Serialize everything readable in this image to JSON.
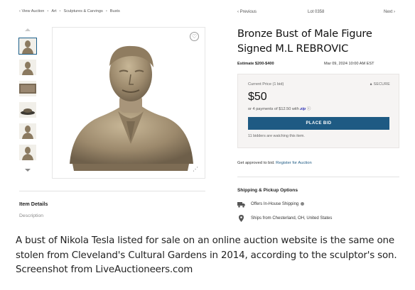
{
  "breadcrumb": {
    "back": "View Auction",
    "items": [
      "Art",
      "Sculptures & Carvings",
      "Busts"
    ],
    "back_glyph": "‹"
  },
  "gallery": {
    "thumbnail_count": 6,
    "selected_index": 0,
    "favorite_icon": "heart-icon",
    "share_icon": "share-icon"
  },
  "nav": {
    "previous": "‹ Previous",
    "lot": "Lot 0358",
    "next": "Next ›"
  },
  "lot": {
    "title": "Bronze Bust of Male Figure Signed M.L REBROVIC",
    "estimate": "Estimate $200-$400",
    "date": "Mar 09, 2024 10:00 AM EST"
  },
  "bidding": {
    "current_label": "Current Price (1 bid)",
    "secure_label": "SECURE",
    "price": "$50",
    "payments_prefix": "or 4 payments of $12.50 with",
    "payments_brand": "zip",
    "button_label": "PLACE BID",
    "watching": "11 bidders are watching this item."
  },
  "approval": {
    "text": "Get approved to bid.",
    "link": "Register for Auction"
  },
  "details": {
    "heading": "Item Details",
    "description_label": "Description"
  },
  "shipping": {
    "heading": "Shipping & Pickup Options",
    "option_1": "Offers In-House Shipping",
    "option_2": "Ships from Chesterland, OH, United States"
  },
  "caption": "A bust of Nikola Tesla listed for sale on an online auction website is the same one stolen from Cleveland's Cultural Gardens in 2014, according to the sculptor's son. Screenshot from LiveAuctioneers.com",
  "colors": {
    "primary_button": "#1e5a83",
    "bid_box_bg": "#f6f4f3",
    "bronze": "#a8957a"
  }
}
